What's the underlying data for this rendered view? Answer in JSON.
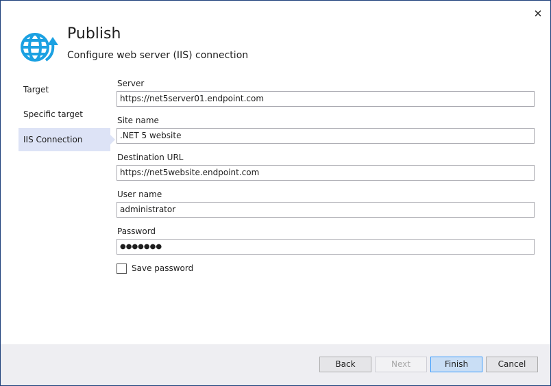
{
  "header": {
    "title": "Publish",
    "subtitle": "Configure web server (IIS) connection",
    "close_icon": "close-icon",
    "logo_icon": "globe-upload-icon"
  },
  "sidebar": {
    "items": [
      {
        "label": "Target",
        "selected": false
      },
      {
        "label": "Specific target",
        "selected": false
      },
      {
        "label": "IIS Connection",
        "selected": true
      }
    ]
  },
  "form": {
    "server": {
      "label": "Server",
      "value": "https://net5server01.endpoint.com"
    },
    "site_name": {
      "label": "Site name",
      "value": ".NET 5 website"
    },
    "destination_url": {
      "label": "Destination URL",
      "value": "https://net5website.endpoint.com"
    },
    "user_name": {
      "label": "User name",
      "value": "administrator"
    },
    "password": {
      "label": "Password",
      "value": "●●●●●●●"
    },
    "save_password": {
      "label": "Save password",
      "checked": false
    }
  },
  "footer": {
    "back": "Back",
    "next": "Next",
    "finish": "Finish",
    "cancel": "Cancel"
  },
  "colors": {
    "accent": "#1ba1e2",
    "selected_nav": "#dde3f6",
    "primary_button": "#c9def5"
  }
}
